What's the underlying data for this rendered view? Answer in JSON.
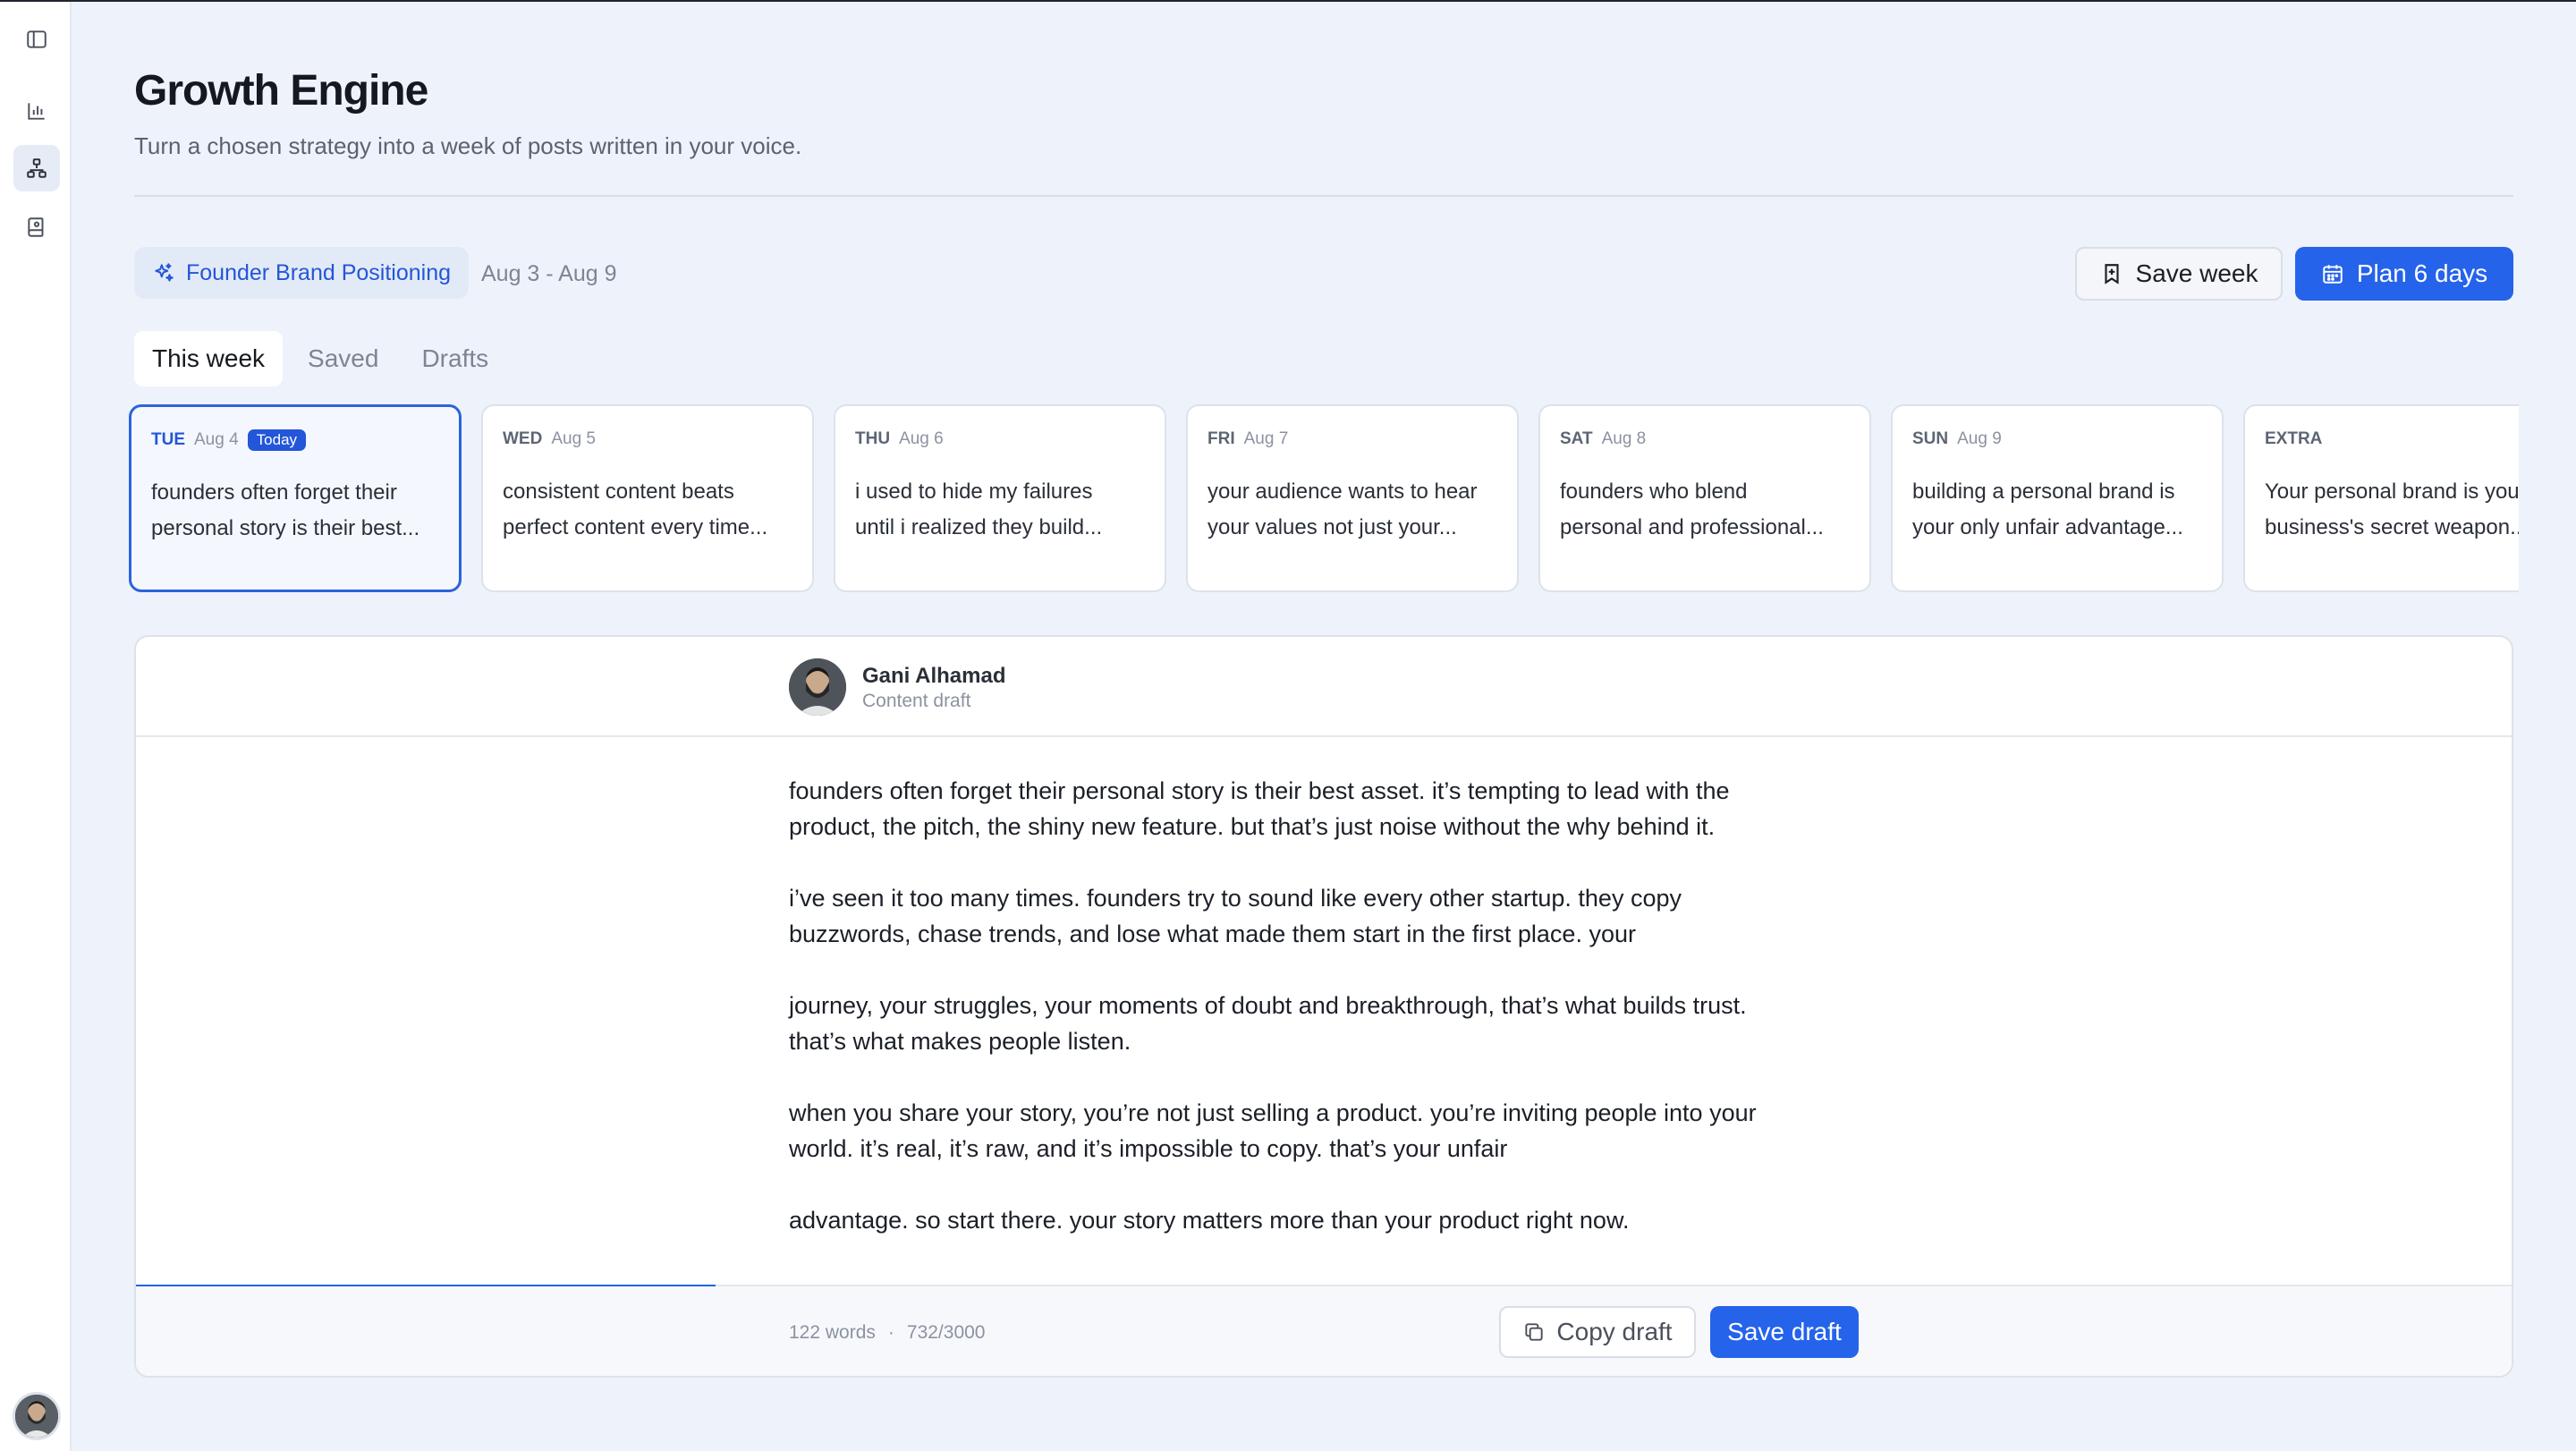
{
  "header": {
    "title": "Growth Engine",
    "subtitle": "Turn a chosen strategy into a week of posts written in your voice."
  },
  "strategy": {
    "name": "Founder Brand Positioning",
    "date_range": "Aug 3 - Aug 9"
  },
  "actions": {
    "save_week": "Save week",
    "plan": "Plan 6 days"
  },
  "tabs": [
    "This week",
    "Saved",
    "Drafts"
  ],
  "days": [
    {
      "day": "TUE",
      "date": "Aug 4",
      "badge": "Today",
      "line1": "founders often forget their",
      "line2": "personal story is their best..."
    },
    {
      "day": "WED",
      "date": "Aug 5",
      "line1": "consistent content beats",
      "line2": "perfect content every time..."
    },
    {
      "day": "THU",
      "date": "Aug 6",
      "line1": "i used to hide my failures",
      "line2": "until i realized they build..."
    },
    {
      "day": "FRI",
      "date": "Aug 7",
      "line1": "your audience wants to hear",
      "line2": "your values not just your..."
    },
    {
      "day": "SAT",
      "date": "Aug 8",
      "line1": "founders who blend",
      "line2": "personal and professional..."
    },
    {
      "day": "SUN",
      "date": "Aug 9",
      "line1": "building a personal brand is",
      "line2": "your only unfair advantage..."
    },
    {
      "day": "EXTRA",
      "date": "",
      "line1": "Your personal brand is your",
      "line2": "business's secret weapon..."
    }
  ],
  "editor": {
    "author": "Gani Alhamad",
    "role": "Content draft",
    "paragraphs": [
      [
        "founders often forget their personal story is their best asset. it’s tempting to lead with the",
        "product, the pitch, the shiny new feature. but that’s just noise without the why behind it."
      ],
      [
        "i’ve seen it too many times. founders try to sound like every other startup. they copy",
        "buzzwords, chase trends, and lose what made them start in the first place. your"
      ],
      [
        "journey, your struggles, your moments of doubt and breakthrough, that’s what builds trust.",
        "that’s what makes people listen."
      ],
      [
        "when you share your story, you’re not just selling a product. you’re inviting people into your",
        "world. it’s real, it’s raw, and it’s impossible to copy. that’s your unfair"
      ],
      [
        "advantage. so start there. your story matters more than your product right now."
      ]
    ],
    "word_count": "122 words",
    "separator": "·",
    "char_count": "732/3000",
    "progress": 0.244,
    "copy_label": "Copy draft",
    "save_label": "Save draft"
  },
  "colors": {
    "accent": "#2563eb",
    "background": "#eef3fb"
  },
  "icons": [
    "sidebar-toggle-icon",
    "chart-icon",
    "hierarchy-icon",
    "notebook-icon",
    "sparkles-icon",
    "bookmark-icon",
    "calendar-icon",
    "copy-icon"
  ]
}
